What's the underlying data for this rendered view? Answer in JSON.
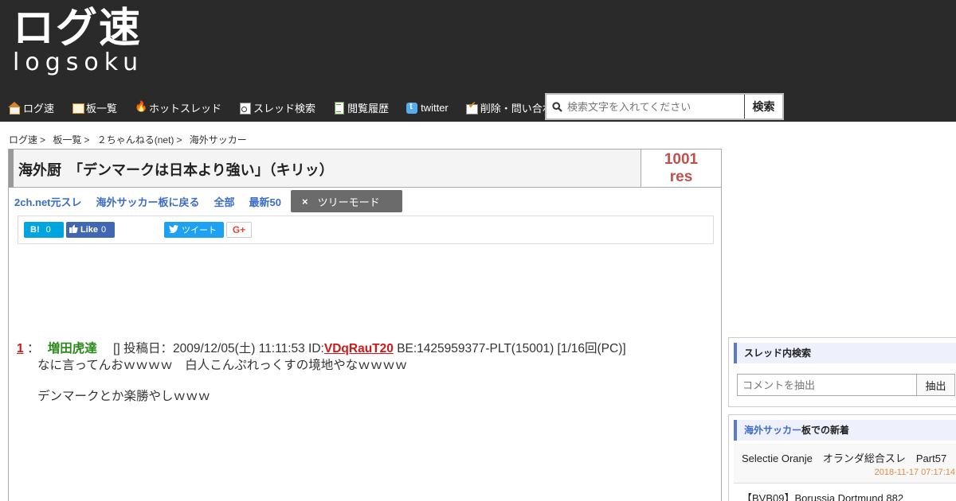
{
  "header": {
    "logo_main": "ログ速",
    "logo_sub": "logsoku",
    "nav": [
      {
        "label": "ログ速",
        "icon": "home-icon"
      },
      {
        "label": "板一覧",
        "icon": "board-icon"
      },
      {
        "label": "ホットスレッド",
        "icon": "fire-icon"
      },
      {
        "label": "スレッド検索",
        "icon": "search-doc-icon"
      },
      {
        "label": "閲覧履歴",
        "icon": "history-icon"
      },
      {
        "label": "twitter",
        "icon": "twitter-icon"
      },
      {
        "label": "削除・問い合わせ",
        "icon": "check-mail-icon"
      }
    ],
    "search_placeholder": "検索文字を入れてください",
    "search_button": "検索"
  },
  "breadcrumb": [
    "ログ速",
    "板一覧",
    "２ちゃんねる(net)",
    "海外サッカー"
  ],
  "breadcrumb_sep": ">",
  "thread": {
    "title": "海外厨　「デンマークは日本より強い」（キリッ）",
    "res_count": "1001",
    "res_label": "res",
    "links": [
      "2ch.net元スレ",
      "海外サッカー板に戻る",
      "全部",
      "最新50"
    ],
    "tree_mode": "ツリーモード",
    "tree_close": "×"
  },
  "share": {
    "hatena_label": "B!",
    "hatena_count": "0",
    "like_label": "Like",
    "like_count": "0",
    "tweet_label": "ツイート",
    "gplus_label": "G+"
  },
  "post": {
    "number": "1",
    "colon": "：",
    "name": "増田虎達",
    "meta_pre": "[] 投稿日：2009/12/05(土) 11:11:53 ID:",
    "id": "VDqRauT20",
    "meta_post": "BE:1425959377-PLT(15001) [1/16回(PC)]",
    "lines": [
      "なに言ってんおｗｗｗｗ　白人こんぷれっくすの境地やなｗｗｗｗ",
      "デンマークとか楽勝やしｗｗｗ"
    ]
  },
  "sidebar": {
    "search_title": "スレッド内検索",
    "search_placeholder": "コメントを抽出",
    "search_button": "抽出",
    "news_board": "海外サッカー",
    "news_suffix": "板での新着",
    "news": [
      {
        "title": "Selectie Oranje　オランダ総合スレ　Part57",
        "time": "2018-11-17 07:17:14"
      },
      {
        "title": "【BVB09】Borussia Dortmund 882",
        "time": ""
      }
    ]
  }
}
